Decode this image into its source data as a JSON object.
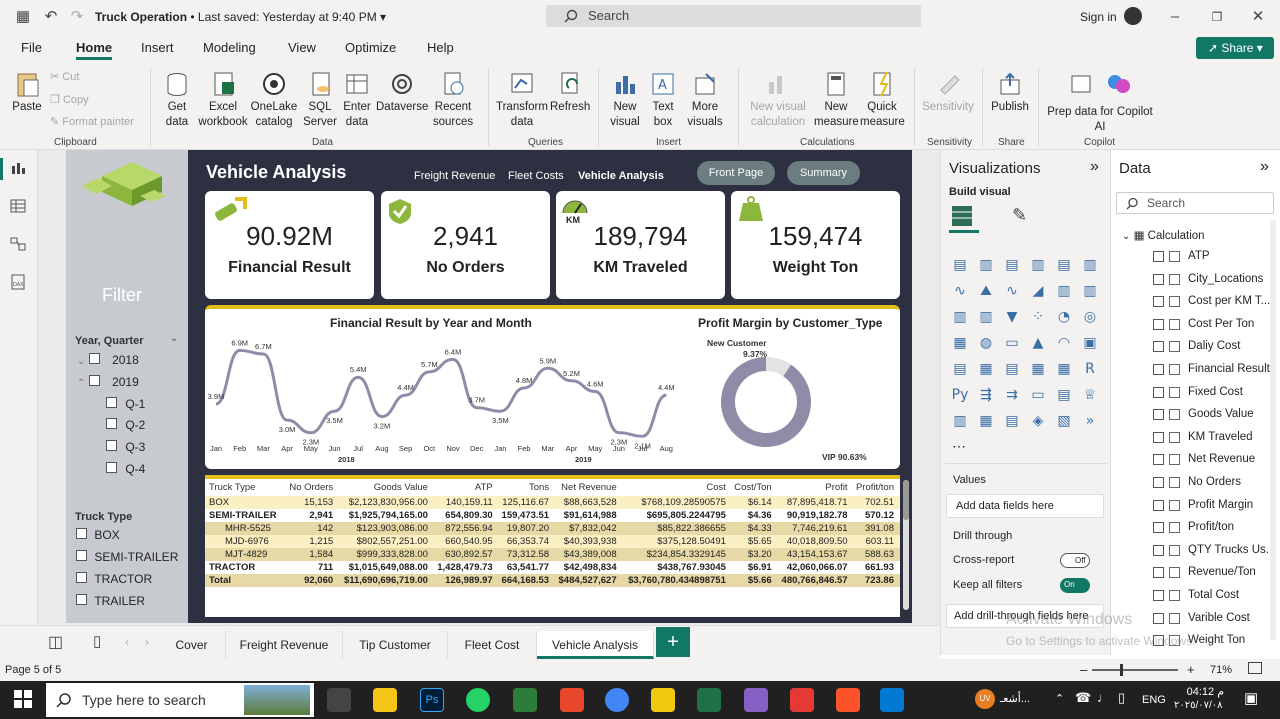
{
  "window": {
    "title": "Truck Operation",
    "saved": "• Last saved: Yesterday at 9:40 PM",
    "search_placeholder": "Search",
    "signin": "Sign in"
  },
  "menu": [
    "File",
    "Home",
    "Insert",
    "Modeling",
    "View",
    "Optimize",
    "Help"
  ],
  "share_label": "Share",
  "ribbon": {
    "clipboard": {
      "paste": "Paste",
      "cut": "Cut",
      "copy": "Copy",
      "format_painter": "Format painter",
      "group": "Clipboard"
    },
    "data": {
      "get_data": "Get data",
      "excel": "Excel workbook",
      "onelake": "OneLake catalog",
      "sql": "SQL Server",
      "enter": "Enter data",
      "dataverse": "Dataverse",
      "recent": "Recent sources",
      "group": "Data"
    },
    "queries": {
      "transform": "Transform data",
      "refresh": "Refresh",
      "group": "Queries"
    },
    "insert": {
      "new_visual": "New visual",
      "text_box": "Text box",
      "more_visuals": "More visuals",
      "group": "Insert"
    },
    "calculations": {
      "new_visual_calc": "New visual calculation",
      "new_measure": "New measure",
      "quick_measure": "Quick measure",
      "group": "Calculations"
    },
    "sensitivity": {
      "label": "Sensitivity",
      "group": "Sensitivity"
    },
    "share": {
      "publish": "Publish",
      "group": "Share"
    },
    "copilot": {
      "prep": "Prep data for Copilot AI",
      "group": "Copilot"
    }
  },
  "report": {
    "title": "Vehicle Analysis",
    "nav": [
      "Freight Revenue",
      "Fleet Costs",
      "Vehicle Analysis"
    ],
    "buttons": [
      "Front Page",
      "Summary"
    ],
    "filter": {
      "title": "Filter",
      "year_quarter_label": "Year, Quarter",
      "years": [
        "2018",
        "2019"
      ],
      "quarters": [
        "Q-1",
        "Q-2",
        "Q-3",
        "Q-4"
      ],
      "truck_type_label": "Truck Type",
      "truck_types": [
        "BOX",
        "SEMI-TRAILER",
        "TRACTOR",
        "TRAILER"
      ]
    },
    "kpis": [
      {
        "value": "90.92M",
        "label": "Financial Result"
      },
      {
        "value": "2,941",
        "label": "No Orders"
      },
      {
        "value": "189,794",
        "label": "KM Traveled",
        "badge": "KM"
      },
      {
        "value": "159,474",
        "label": "Weight Ton"
      }
    ]
  },
  "chart_data": [
    {
      "type": "line",
      "title": "Financial Result by Year and Month",
      "categories": [
        "Jan",
        "Feb",
        "Mar",
        "Apr",
        "May",
        "Jun",
        "Jul",
        "Aug",
        "Sep",
        "Oct",
        "Nov",
        "Dec",
        "Jan",
        "Feb",
        "Mar",
        "Apr",
        "May",
        "Jun",
        "Jul",
        "Aug"
      ],
      "year_labels": [
        "2018",
        "2019"
      ],
      "values": [
        3.9,
        6.9,
        6.7,
        3.0,
        2.3,
        3.5,
        5.4,
        3.2,
        4.4,
        5.7,
        6.4,
        3.7,
        3.5,
        4.8,
        5.9,
        5.2,
        4.6,
        2.3,
        2.1,
        4.4
      ],
      "data_labels": [
        "3.9M",
        "6.9M",
        "6.7M",
        "3.0M",
        "2.3M",
        "3.5M",
        "5.4M",
        "3.2M",
        "4.4M",
        "5.7M",
        "6.4M",
        "3.7M",
        "3.5M",
        "4.8M",
        "5.9M",
        "5.2M",
        "4.6M",
        "2.3M",
        "2.1M",
        "4.4M"
      ]
    },
    {
      "type": "pie",
      "title": "Profit Margin by Customer_Type",
      "categories": [
        "New Customer",
        "VIP"
      ],
      "values": [
        9.37,
        90.63
      ],
      "data_labels": [
        "9.37%",
        "VIP 90.63%"
      ]
    },
    {
      "type": "table",
      "columns": [
        "Truck Type",
        "No Orders",
        "Goods Value",
        "ATP",
        "Tons",
        "Net Revenue",
        "Cost",
        "Cost/Ton",
        "Profit",
        "Profit/ton"
      ],
      "rows": [
        {
          "kind": "box",
          "cells": [
            "BOX",
            "15,153",
            "$2,123,830,956.00",
            "140,159.11",
            "125,116.67",
            "$88,663,528",
            "$768,109.28590575",
            "$6.14",
            "87,895,418.71",
            "702.51"
          ]
        },
        {
          "kind": "semi",
          "cells": [
            "SEMI-TRAILER",
            "2,941",
            "$1,925,794,165.00",
            "654,809.30",
            "159,473.51",
            "$91,614,988",
            "$695,805.2244795",
            "$4.36",
            "90,919,182.78",
            "570.12"
          ]
        },
        {
          "kind": "sub",
          "cells": [
            "MHR-5525",
            "142",
            "$123,903,086.00",
            "872,556.94",
            "19,807.20",
            "$7,832,042",
            "$85,822.386655",
            "$4.33",
            "7,746,219.61",
            "391.08"
          ]
        },
        {
          "kind": "box",
          "cells": [
            "MJD-6976",
            "1,215",
            "$802,557,251.00",
            "660,540.95",
            "66,353.74",
            "$40,393,938",
            "$375,128.50491",
            "$5.65",
            "40,018,809.50",
            "603.11"
          ]
        },
        {
          "kind": "sub",
          "cells": [
            "MJT-4829",
            "1,584",
            "$999,333,828.00",
            "630,892.57",
            "73,312.58",
            "$43,389,008",
            "$234,854.3329145",
            "$3.20",
            "43,154,153.67",
            "588.63"
          ]
        },
        {
          "kind": "semi",
          "cells": [
            "TRACTOR",
            "711",
            "$1,015,649,088.00",
            "1,428,479.73",
            "63,541.77",
            "$42,498,834",
            "$438,767.93045",
            "$6.91",
            "42,060,066.07",
            "661.93"
          ]
        },
        {
          "kind": "tot",
          "cells": [
            "Total",
            "92,060",
            "$11,690,696,719.00",
            "126,989.97",
            "664,168.53",
            "$484,527,627",
            "$3,760,780.434898751",
            "$5.66",
            "480,766,846.57",
            "723.86"
          ]
        }
      ]
    }
  ],
  "viz_pane": {
    "title": "Visualizations",
    "build": "Build visual",
    "values_label": "Values",
    "add_fields": "Add data fields here",
    "drill_label": "Drill through",
    "cross_report": "Cross-report",
    "cross_state": "Off",
    "keep_filters": "Keep all filters",
    "keep_state": "On",
    "add_drill": "Add drill-through fields here"
  },
  "data_pane": {
    "title": "Data",
    "search_placeholder": "Search",
    "table_name": "Calculation",
    "fields": [
      "ATP",
      "City_Locations",
      "Cost per KM T...",
      "Cost Per Ton",
      "Daliy Cost",
      "Financial Result",
      "Fixed Cost",
      "Goods Value",
      "KM Traveled",
      "Net Revenue",
      "No Orders",
      "Profit Margin",
      "Profit/ton",
      "QTY Trucks Us...",
      "Revenue/Ton",
      "Total Cost",
      "Varible Cost",
      "Weight Ton"
    ]
  },
  "tabs": [
    "Cover",
    "Freight Revenue",
    "Tip Customer",
    "Fleet Cost",
    "Vehicle Analysis"
  ],
  "status": {
    "page": "Page 5 of 5",
    "zoom": "71%"
  },
  "watermark": {
    "line1": "Activate Windows",
    "line2": "Go to Settings to activate Windows."
  },
  "taskbar": {
    "search": "Type here to search",
    "lang": "ENG",
    "time": "04:12 م",
    "date": "٢٠٢٥/٠٧/٠٨",
    "notif": "أشعـ..."
  },
  "colors": {
    "accent": "#117865",
    "gold": "#e5bd1a",
    "report_bg": "#2c3040",
    "line": "#8f8ca8"
  }
}
